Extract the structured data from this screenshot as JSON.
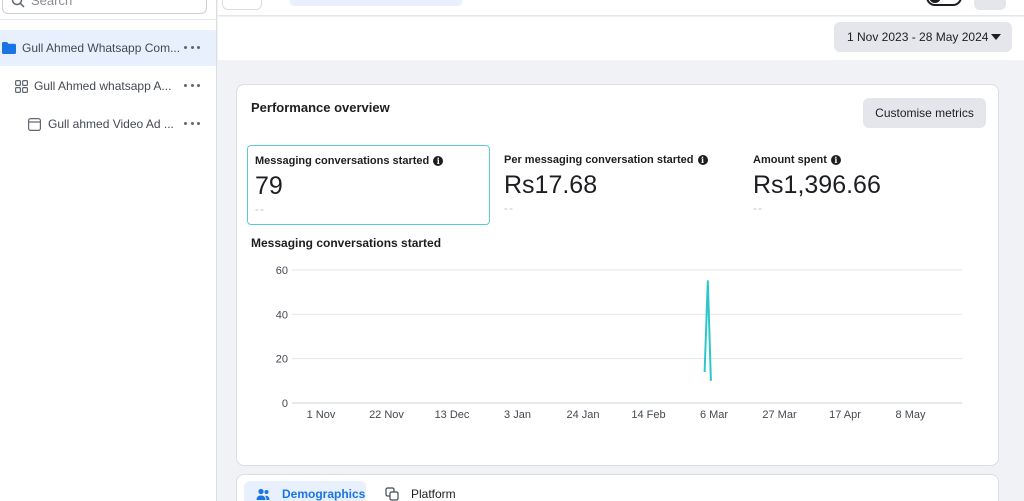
{
  "sidebar": {
    "search": {
      "placeholder": "Search"
    },
    "tree": [
      {
        "label": "Gull Ahmed Whatsapp Com...",
        "icon": "folder-icon",
        "active": true
      },
      {
        "label": "Gull Ahmed whatsapp A...",
        "icon": "grid-icon",
        "active": false
      },
      {
        "label": "Gull ahmed Video Ad ...",
        "icon": "ad-icon",
        "active": false
      }
    ]
  },
  "header": {
    "date_range": "1 Nov 2023 - 28 May 2024"
  },
  "performance": {
    "title": "Performance overview",
    "customise_label": "Customise metrics",
    "metrics": [
      {
        "label": "Messaging conversations started",
        "value": "79",
        "compare": "--",
        "selected": true
      },
      {
        "label": "Per messaging conversation started",
        "value": "Rs17.68",
        "compare": "--",
        "selected": false
      },
      {
        "label": "Amount spent",
        "value": "Rs1,396.66",
        "compare": "--",
        "selected": false
      }
    ],
    "chart_title": "Messaging conversations started"
  },
  "chart_data": {
    "type": "line",
    "title": "Messaging conversations started",
    "xlabel": "",
    "ylabel": "",
    "x_ticks": [
      "1 Nov",
      "22 Nov",
      "13 Dec",
      "3 Jan",
      "24 Jan",
      "14 Feb",
      "6 Mar",
      "27 Mar",
      "17 Apr",
      "8 May"
    ],
    "y_ticks": [
      0,
      20,
      40,
      60
    ],
    "ylim": [
      0,
      60
    ],
    "grid": true,
    "line_color": "#2ec7c9",
    "series": [
      {
        "points": [
          {
            "x": "2024-03-03",
            "y": 14
          },
          {
            "x": "2024-03-04",
            "y": 55
          },
          {
            "x": "2024-03-05",
            "y": 10
          }
        ]
      }
    ]
  },
  "tabs": [
    {
      "label": "Demographics",
      "icon": "people-icon",
      "active": true
    },
    {
      "label": "Platform",
      "icon": "platform-icon",
      "active": false
    }
  ]
}
